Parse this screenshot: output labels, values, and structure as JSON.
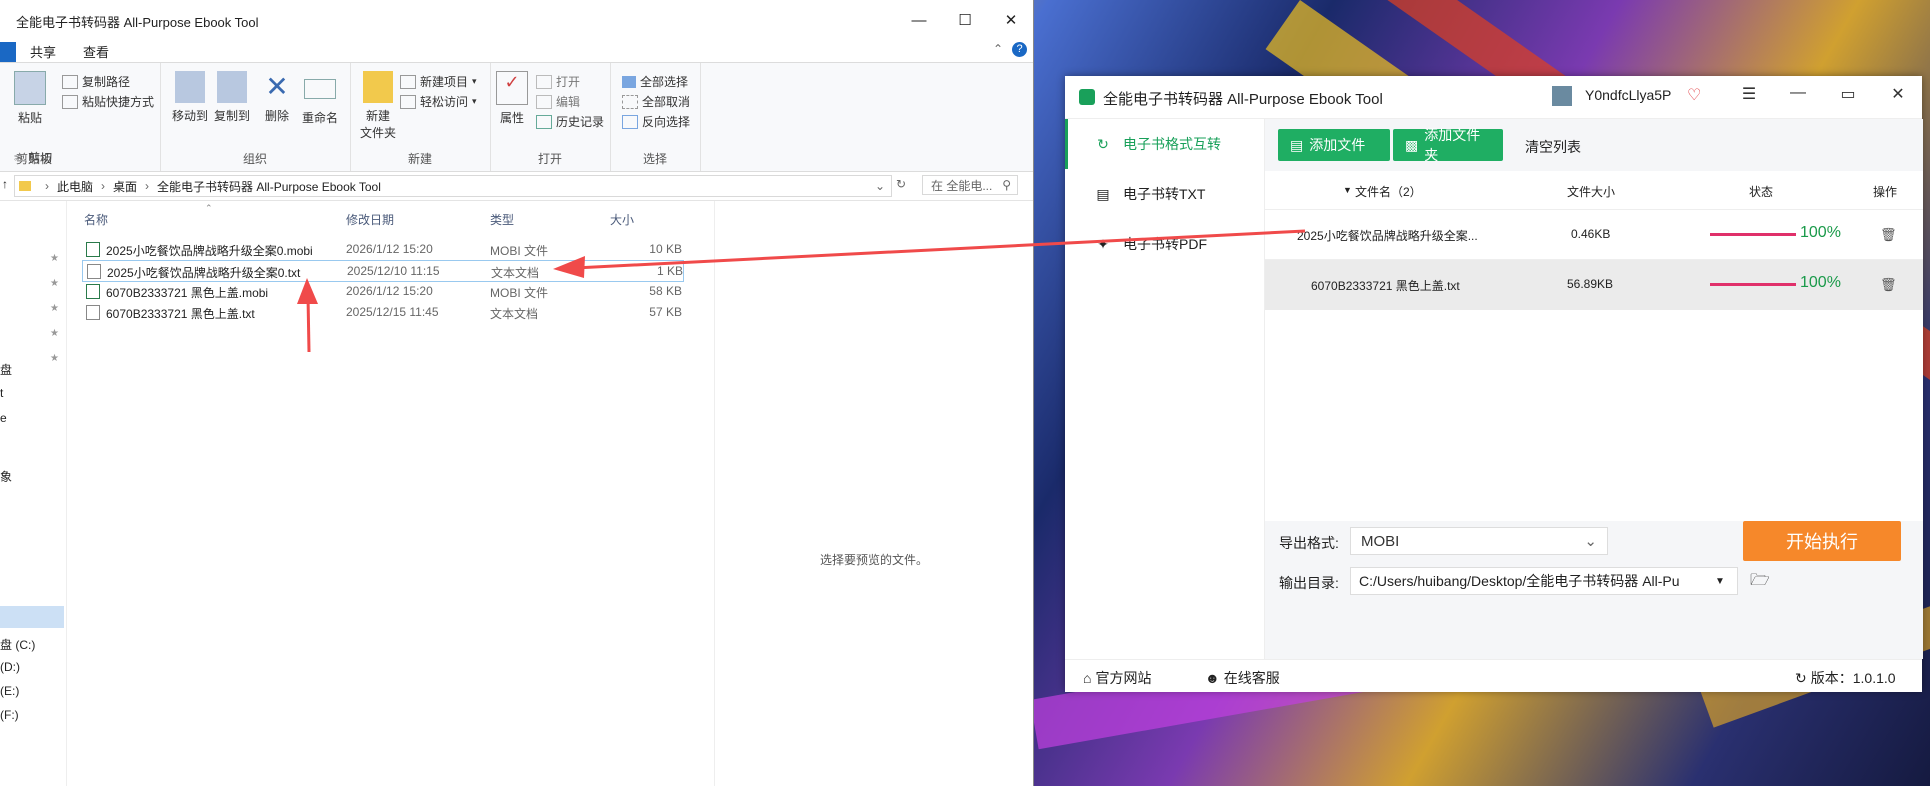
{
  "explorer": {
    "title": "全能电子书转码器 All-Purpose Ebook Tool",
    "tabs": [
      "共享",
      "查看"
    ],
    "ribbon": {
      "clipboard": {
        "paste": "粘贴",
        "copy_path": "复制路径",
        "paste_shortcut": "粘贴快捷方式",
        "cut": "剪切",
        "group": "剪贴板"
      },
      "organize": {
        "move_to": "移动到",
        "copy_to": "复制到",
        "delete": "删除",
        "rename": "重命名",
        "group": "组织"
      },
      "new": {
        "new_item": "新建项目",
        "easy_access": "轻松访问",
        "new_folder": "新建\n文件夹",
        "group": "新建"
      },
      "open": {
        "properties": "属性",
        "open": "打开",
        "edit": "编辑",
        "history": "历史记录",
        "group": "打开"
      },
      "select": {
        "select_all": "全部选择",
        "select_none": "全部取消",
        "invert": "反向选择",
        "group": "选择"
      }
    },
    "breadcrumb": [
      "此电脑",
      "桌面",
      "全能电子书转码器 All-Purpose Ebook Tool"
    ],
    "search_placeholder": "在 全能电...",
    "columns": {
      "name": "名称",
      "date": "修改日期",
      "type": "类型",
      "size": "大小"
    },
    "files": [
      {
        "name": "2025小吃餐饮品牌战略升级全案0.mobi",
        "date": "2026/1/12 15:20",
        "type": "MOBI 文件",
        "size": "10 KB"
      },
      {
        "name": "2025小吃餐饮品牌战略升级全案0.txt",
        "date": "2025/12/10 11:15",
        "type": "文本文档",
        "size": "1 KB"
      },
      {
        "name": "6070B2333721 黑色上盖.mobi",
        "date": "2026/1/12 15:20",
        "type": "MOBI 文件",
        "size": "58 KB"
      },
      {
        "name": "6070B2333721 黑色上盖.txt",
        "date": "2025/12/15 11:45",
        "type": "文本文档",
        "size": "57 KB"
      }
    ],
    "nav_items": [
      "盘",
      "t",
      "e",
      "象",
      "盘 (C:)",
      "(D:)",
      "(E:)",
      "(F:)"
    ],
    "preview_text": "选择要预览的文件。"
  },
  "app": {
    "title": "全能电子书转码器 All-Purpose Ebook Tool",
    "username": "Y0ndfcLlya5P",
    "sidebar": [
      {
        "label": "电子书格式互转"
      },
      {
        "label": "电子书转TXT"
      },
      {
        "label": "电子书转PDF"
      }
    ],
    "buttons": {
      "add_file": "添加文件",
      "add_folder": "添加文件夹",
      "clear": "清空列表"
    },
    "columns": {
      "name": "文件名（2）",
      "size": "文件大小",
      "status": "状态",
      "action": "操作"
    },
    "rows": [
      {
        "name": "2025小吃餐饮品牌战略升级全案...",
        "size": "0.46KB",
        "progress": "100%"
      },
      {
        "name": "6070B2333721 黑色上盖.txt",
        "size": "56.89KB",
        "progress": "100%"
      }
    ],
    "export_label": "导出格式:",
    "export_value": "MOBI",
    "output_label": "输出目录:",
    "output_value": "C:/Users/huibang/Desktop/全能电子书转码器 All-Pu",
    "run": "开始执行",
    "status": {
      "website": "官方网站",
      "support": "在线客服",
      "version": "版本：1.0.1.0"
    }
  }
}
